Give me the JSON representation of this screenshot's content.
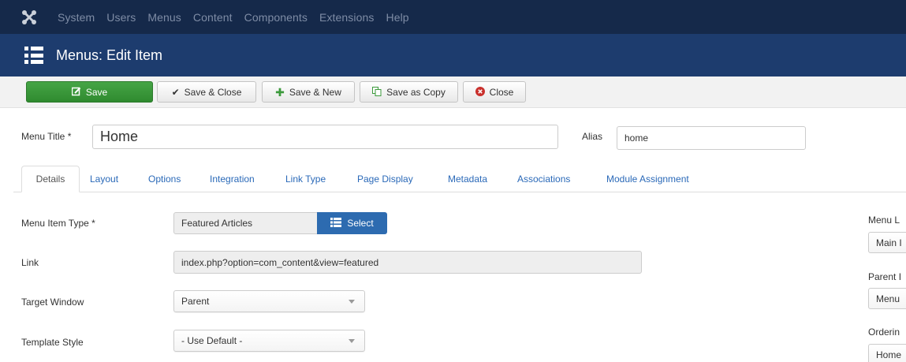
{
  "topnav": {
    "logo_icon": "joomla-logo-icon",
    "items": [
      "System",
      "Users",
      "Menus",
      "Content",
      "Components",
      "Extensions",
      "Help"
    ]
  },
  "header": {
    "icon": "list-icon",
    "title": "Menus: Edit Item"
  },
  "toolbar": {
    "save": "Save",
    "save_close": "Save & Close",
    "save_new": "Save & New",
    "save_copy": "Save as Copy",
    "close": "Close"
  },
  "form": {
    "menu_title_label": "Menu Title *",
    "menu_title_value": "Home",
    "alias_label": "Alias",
    "alias_value": "home"
  },
  "tabs": [
    "Details",
    "Layout",
    "Options",
    "Integration",
    "Link Type",
    "Page Display",
    "Metadata",
    "Associations",
    "Module Assignment"
  ],
  "details": {
    "menu_item_type_label": "Menu Item Type *",
    "menu_item_type_value": "Featured Articles",
    "select_label": "Select",
    "link_label": "Link",
    "link_value": "index.php?option=com_content&view=featured",
    "target_window_label": "Target Window",
    "target_window_value": "Parent",
    "template_style_label": "Template Style",
    "template_style_value": "- Use Default -"
  },
  "sidebar": {
    "menu_label": "Menu L",
    "menu_value": "Main I",
    "parent_label": "Parent I",
    "parent_value": "Menu",
    "ordering_label": "Orderin",
    "ordering_value": "Home"
  },
  "colors": {
    "topnav_bg": "#15294a",
    "header_bg": "#1d3c6e",
    "save_green": "#46a546",
    "select_blue": "#2d6bb0",
    "link_blue": "#2a69b8",
    "close_red": "#c9302c"
  }
}
